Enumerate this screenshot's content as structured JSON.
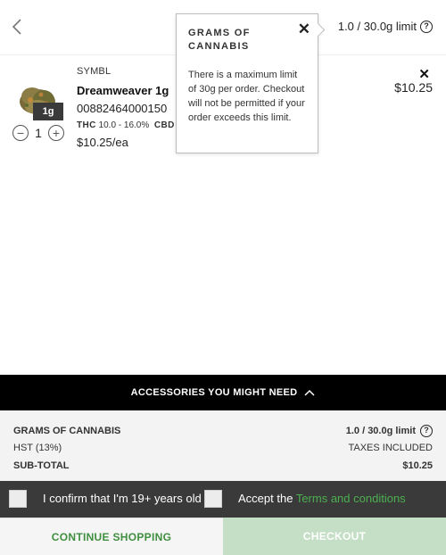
{
  "header": {
    "back_icon": "chevron-left-icon",
    "limit_text": "1.0 / 30.0g limit",
    "info_icon": "info-icon"
  },
  "cart_item": {
    "brand": "SYMBL",
    "name": "Dreamweaver 1g",
    "sku": "00882464000150",
    "thc_label": "THC",
    "thc_value": "10.0 - 16.0%",
    "cbd_label": "CBD",
    "unit_price": "$10.25/ea",
    "weight_badge": "1g",
    "quantity": "1",
    "line_price": "$10.25",
    "remove_icon": "close-icon",
    "minus_icon": "minus-circle-icon",
    "plus_icon": "plus-circle-icon"
  },
  "tooltip": {
    "title": "GRAMS OF CANNABIS",
    "body": "There is a maximum limit of 30g per order. Checkout will not be permitted if your order exceeds this limit.",
    "close_icon": "close-icon"
  },
  "accessories": {
    "label": "ACCESSORIES YOU MIGHT NEED",
    "icon": "chevron-up-icon"
  },
  "summary": {
    "grams_label": "GRAMS OF CANNABIS",
    "grams_value": "1.0 / 30.0g limit",
    "tax_label": "HST (13%)",
    "tax_value": "TAXES INCLUDED",
    "subtotal_label": "SUB-TOTAL",
    "subtotal_value": "$10.25"
  },
  "confirm": {
    "age_text": "I confirm that I'm 19+ years old",
    "accept_prefix": "Accept the",
    "terms_link": "Terms and conditions"
  },
  "actions": {
    "continue_label": "CONTINUE SHOPPING",
    "checkout_label": "CHECKOUT"
  },
  "colors": {
    "accent_green": "#4caf50",
    "continue_text": "#3f8f3f",
    "checkout_disabled": "#c4dfc6",
    "dark_bar": "#3a3a3a"
  }
}
